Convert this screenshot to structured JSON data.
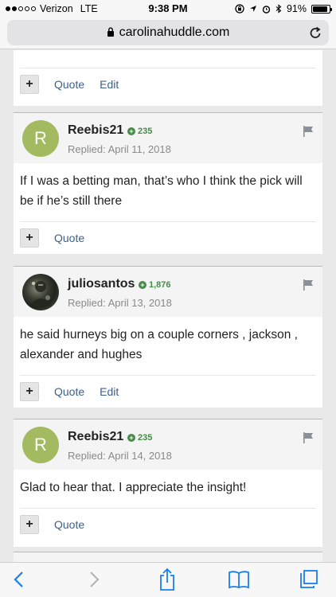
{
  "status_bar": {
    "carrier": "Verizon",
    "network": "LTE",
    "time": "9:38 PM",
    "battery": "91%",
    "battery_fraction": 0.91
  },
  "browser": {
    "host": "carolinahuddle.com"
  },
  "top_post": {
    "quote_label": "Quote",
    "edit_label": "Edit"
  },
  "posts": [
    {
      "username": "Reebis21",
      "avatar_letter": "R",
      "reputation": "235",
      "replied": "Replied: April 11, 2018",
      "text": "If I was a betting man, that’s who I think the pick will be if he’s still there",
      "quote_label": "Quote"
    },
    {
      "username": "juliosantos",
      "reputation": "1,876",
      "replied": "Replied: April 13, 2018",
      "text": "he said hurneys big on a couple corners , jackson , alexander and hughes",
      "quote_label": "Quote",
      "edit_label": "Edit"
    },
    {
      "username": "Reebis21",
      "avatar_letter": "R",
      "reputation": "235",
      "replied": "Replied: April 14, 2018",
      "text": "Glad to hear that. I appreciate the insight!",
      "quote_label": "Quote"
    }
  ],
  "colors": {
    "link": "#3e5f8a",
    "reputation": "#478a4a",
    "avatar_bg": "#a3ba60",
    "ios_blue": "#1a7df1"
  },
  "icons": [
    "lock-icon",
    "reload-icon",
    "flag-icon",
    "back-icon",
    "forward-icon",
    "share-icon",
    "bookmarks-icon",
    "tabs-icon"
  ]
}
